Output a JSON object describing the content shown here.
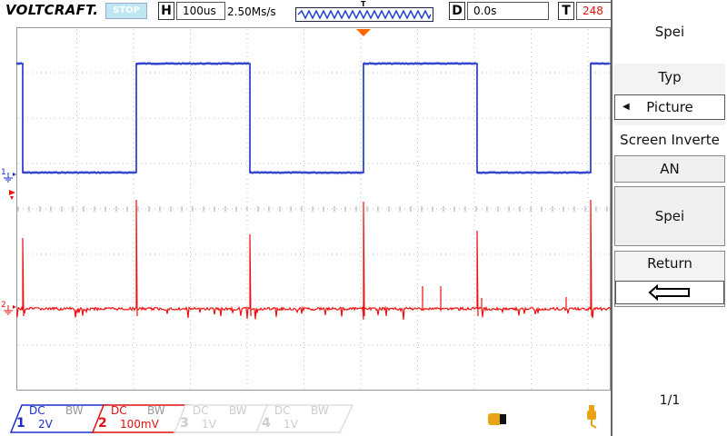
{
  "brand": "VOLTCRAFT.",
  "run_state": "STOP",
  "horizontal": {
    "letter": "H",
    "value": "100us"
  },
  "sample_rate": "2.50Ms/s",
  "trigger_bar_marker": "T",
  "delay": {
    "letter": "D",
    "value": "0.0s"
  },
  "trigger": {
    "letter": "T",
    "value": "248"
  },
  "channel_markers": {
    "ch1": "1",
    "ch2": "2"
  },
  "menu": {
    "title": "Spei",
    "typ_label": "Typ",
    "typ_value": "Picture",
    "screen_invert_label": "Screen Inverte",
    "screen_invert_value": "AN",
    "save_label": "Spei",
    "return_label": "Return",
    "page": "1/1"
  },
  "channels": [
    {
      "num": "1",
      "coupling": "DC",
      "bw": "BW",
      "scale": "2V",
      "color": "#1a2ecc"
    },
    {
      "num": "2",
      "coupling": "DC",
      "bw": "BW",
      "scale": "100mV",
      "color": "#dd1111"
    },
    {
      "num": "3",
      "coupling": "DC",
      "bw": "BW",
      "scale": "1V",
      "color": "#cccccc"
    },
    {
      "num": "4",
      "coupling": "DC",
      "bw": "BW",
      "scale": "1V",
      "color": "#cccccc"
    }
  ],
  "colors": {
    "ch1": "#1a2ecc",
    "ch2": "#ee1111",
    "grid": "#bbbbbb",
    "trigger": "#ff6600"
  }
}
